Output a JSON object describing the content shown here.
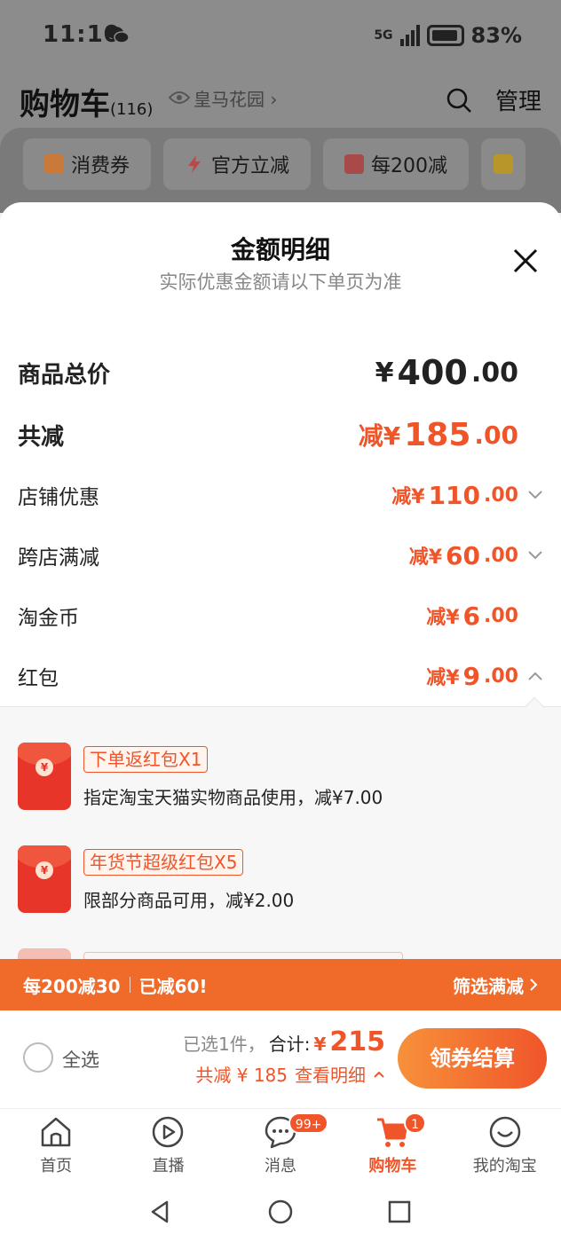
{
  "status_bar": {
    "time": "11:10",
    "network": "5G",
    "battery": "83%"
  },
  "cart_header": {
    "title": "购物车",
    "count": "(116)",
    "address": "皇马花园",
    "manage_label": "管理",
    "chips": [
      {
        "icon": "coupon-icon",
        "label": "消费券"
      },
      {
        "icon": "lightning-icon",
        "label": "官方立减"
      },
      {
        "icon": "store-icon",
        "label": "每200减"
      },
      {
        "icon": "folder-icon",
        "label": ""
      }
    ]
  },
  "sheet": {
    "title": "金额明细",
    "subtitle": "实际优惠金额请以下单页为准",
    "goods_total": {
      "label": "商品总价",
      "prefix": "¥",
      "int": "400",
      "dec": ".00"
    },
    "total_discount": {
      "label": "共减",
      "prefix": "减¥",
      "int": "185",
      "dec": ".00"
    },
    "details": [
      {
        "label": "店铺优惠",
        "prefix": "减¥",
        "int": "110",
        "dec": ".00",
        "chevron": "down"
      },
      {
        "label": "跨店满减",
        "prefix": "减¥",
        "int": "60",
        "dec": ".00",
        "chevron": "down"
      },
      {
        "label": "淘金币",
        "prefix": "减¥",
        "int": "6",
        "dec": ".00",
        "chevron": "none"
      },
      {
        "label": "红包",
        "prefix": "减¥",
        "int": "9",
        "dec": ".00",
        "chevron": "up"
      }
    ],
    "red_packets": [
      {
        "tag": "下单返红包X1",
        "desc": "指定淘宝天猫实物商品使用，减¥7.00"
      },
      {
        "tag": "年货节超级红包X5",
        "desc": "限部分商品可用，减¥2.00"
      }
    ]
  },
  "promo_bar": {
    "left": "每200减30",
    "middle": "已减60!",
    "right": "筛选满减"
  },
  "checkout": {
    "select_all": "全选",
    "selected_text": "已选1件，",
    "total_label": "合计:",
    "total_yen": "¥",
    "total_value": "215",
    "discount_text": "共减 ¥ 185",
    "detail_link": "查看明细",
    "button_label": "领券结算"
  },
  "bottom_nav": {
    "items": [
      {
        "label": "首页",
        "icon": "home-icon"
      },
      {
        "label": "直播",
        "icon": "live-icon"
      },
      {
        "label": "消息",
        "icon": "message-icon",
        "badge": "99+"
      },
      {
        "label": "购物车",
        "icon": "cart-icon",
        "badge": "1",
        "active": true
      },
      {
        "label": "我的淘宝",
        "icon": "profile-icon"
      }
    ]
  },
  "colors": {
    "accent": "#f0552a",
    "promo": "#f06a2a",
    "button_start": "#f7913a"
  }
}
